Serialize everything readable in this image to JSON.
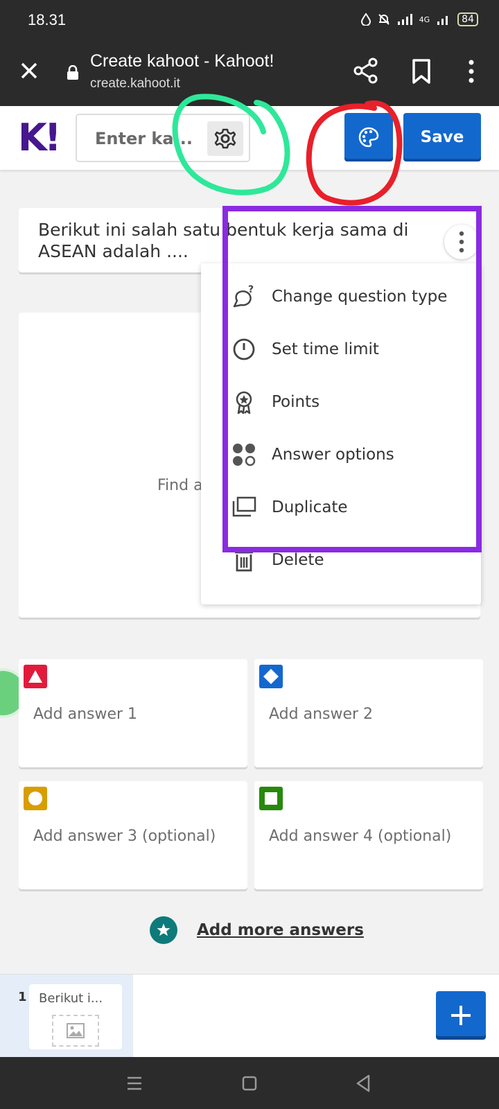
{
  "status_bar": {
    "time": "18.31",
    "network_label": "4G",
    "battery": "84"
  },
  "browser": {
    "title": "Create kahoot - Kahoot!",
    "url": "create.kahoot.it"
  },
  "header": {
    "logo": "K!",
    "title_placeholder": "Enter ka...",
    "save_label": "Save"
  },
  "question": {
    "text": "Berikut ini salah satu bentuk kerja sama di ASEAN adalah ...."
  },
  "media": {
    "text": "Find a"
  },
  "menu": {
    "items": [
      {
        "label": "Change question type",
        "icon": "question-type-icon"
      },
      {
        "label": "Set time limit",
        "icon": "timer-icon"
      },
      {
        "label": "Points",
        "icon": "award-icon"
      },
      {
        "label": "Answer options",
        "icon": "answer-options-icon"
      },
      {
        "label": "Duplicate",
        "icon": "duplicate-icon"
      },
      {
        "label": "Delete",
        "icon": "trash-icon"
      }
    ]
  },
  "answers": [
    {
      "label": "Add answer 1",
      "shape": "triangle",
      "color": "#e21b3c"
    },
    {
      "label": "Add answer 2",
      "shape": "diamond",
      "color": "#1368ce"
    },
    {
      "label": "Add answer 3 (optional)",
      "shape": "circle",
      "color": "#d89e00"
    },
    {
      "label": "Add answer 4 (optional)",
      "shape": "square",
      "color": "#26890c"
    }
  ],
  "add_more": {
    "label": "Add more answers"
  },
  "slides": {
    "number": "1",
    "thumb_text": "Berikut i..."
  },
  "colors": {
    "kahoot_purple": "#46178f",
    "primary_blue": "#1368ce",
    "annotation_green": "#2ee89a",
    "annotation_red": "#e8202a",
    "annotation_purple": "#8a2be2"
  }
}
